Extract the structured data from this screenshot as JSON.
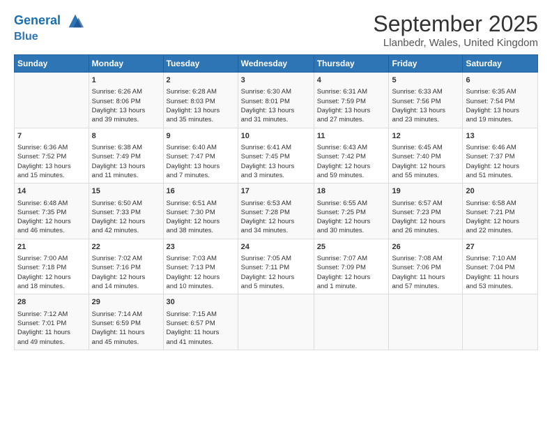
{
  "header": {
    "logo_line1": "General",
    "logo_line2": "Blue",
    "month": "September 2025",
    "location": "Llanbedr, Wales, United Kingdom"
  },
  "weekdays": [
    "Sunday",
    "Monday",
    "Tuesday",
    "Wednesday",
    "Thursday",
    "Friday",
    "Saturday"
  ],
  "weeks": [
    [
      {
        "day": "",
        "content": ""
      },
      {
        "day": "1",
        "content": "Sunrise: 6:26 AM\nSunset: 8:06 PM\nDaylight: 13 hours\nand 39 minutes."
      },
      {
        "day": "2",
        "content": "Sunrise: 6:28 AM\nSunset: 8:03 PM\nDaylight: 13 hours\nand 35 minutes."
      },
      {
        "day": "3",
        "content": "Sunrise: 6:30 AM\nSunset: 8:01 PM\nDaylight: 13 hours\nand 31 minutes."
      },
      {
        "day": "4",
        "content": "Sunrise: 6:31 AM\nSunset: 7:59 PM\nDaylight: 13 hours\nand 27 minutes."
      },
      {
        "day": "5",
        "content": "Sunrise: 6:33 AM\nSunset: 7:56 PM\nDaylight: 13 hours\nand 23 minutes."
      },
      {
        "day": "6",
        "content": "Sunrise: 6:35 AM\nSunset: 7:54 PM\nDaylight: 13 hours\nand 19 minutes."
      }
    ],
    [
      {
        "day": "7",
        "content": "Sunrise: 6:36 AM\nSunset: 7:52 PM\nDaylight: 13 hours\nand 15 minutes."
      },
      {
        "day": "8",
        "content": "Sunrise: 6:38 AM\nSunset: 7:49 PM\nDaylight: 13 hours\nand 11 minutes."
      },
      {
        "day": "9",
        "content": "Sunrise: 6:40 AM\nSunset: 7:47 PM\nDaylight: 13 hours\nand 7 minutes."
      },
      {
        "day": "10",
        "content": "Sunrise: 6:41 AM\nSunset: 7:45 PM\nDaylight: 13 hours\nand 3 minutes."
      },
      {
        "day": "11",
        "content": "Sunrise: 6:43 AM\nSunset: 7:42 PM\nDaylight: 12 hours\nand 59 minutes."
      },
      {
        "day": "12",
        "content": "Sunrise: 6:45 AM\nSunset: 7:40 PM\nDaylight: 12 hours\nand 55 minutes."
      },
      {
        "day": "13",
        "content": "Sunrise: 6:46 AM\nSunset: 7:37 PM\nDaylight: 12 hours\nand 51 minutes."
      }
    ],
    [
      {
        "day": "14",
        "content": "Sunrise: 6:48 AM\nSunset: 7:35 PM\nDaylight: 12 hours\nand 46 minutes."
      },
      {
        "day": "15",
        "content": "Sunrise: 6:50 AM\nSunset: 7:33 PM\nDaylight: 12 hours\nand 42 minutes."
      },
      {
        "day": "16",
        "content": "Sunrise: 6:51 AM\nSunset: 7:30 PM\nDaylight: 12 hours\nand 38 minutes."
      },
      {
        "day": "17",
        "content": "Sunrise: 6:53 AM\nSunset: 7:28 PM\nDaylight: 12 hours\nand 34 minutes."
      },
      {
        "day": "18",
        "content": "Sunrise: 6:55 AM\nSunset: 7:25 PM\nDaylight: 12 hours\nand 30 minutes."
      },
      {
        "day": "19",
        "content": "Sunrise: 6:57 AM\nSunset: 7:23 PM\nDaylight: 12 hours\nand 26 minutes."
      },
      {
        "day": "20",
        "content": "Sunrise: 6:58 AM\nSunset: 7:21 PM\nDaylight: 12 hours\nand 22 minutes."
      }
    ],
    [
      {
        "day": "21",
        "content": "Sunrise: 7:00 AM\nSunset: 7:18 PM\nDaylight: 12 hours\nand 18 minutes."
      },
      {
        "day": "22",
        "content": "Sunrise: 7:02 AM\nSunset: 7:16 PM\nDaylight: 12 hours\nand 14 minutes."
      },
      {
        "day": "23",
        "content": "Sunrise: 7:03 AM\nSunset: 7:13 PM\nDaylight: 12 hours\nand 10 minutes."
      },
      {
        "day": "24",
        "content": "Sunrise: 7:05 AM\nSunset: 7:11 PM\nDaylight: 12 hours\nand 5 minutes."
      },
      {
        "day": "25",
        "content": "Sunrise: 7:07 AM\nSunset: 7:09 PM\nDaylight: 12 hours\nand 1 minute."
      },
      {
        "day": "26",
        "content": "Sunrise: 7:08 AM\nSunset: 7:06 PM\nDaylight: 11 hours\nand 57 minutes."
      },
      {
        "day": "27",
        "content": "Sunrise: 7:10 AM\nSunset: 7:04 PM\nDaylight: 11 hours\nand 53 minutes."
      }
    ],
    [
      {
        "day": "28",
        "content": "Sunrise: 7:12 AM\nSunset: 7:01 PM\nDaylight: 11 hours\nand 49 minutes."
      },
      {
        "day": "29",
        "content": "Sunrise: 7:14 AM\nSunset: 6:59 PM\nDaylight: 11 hours\nand 45 minutes."
      },
      {
        "day": "30",
        "content": "Sunrise: 7:15 AM\nSunset: 6:57 PM\nDaylight: 11 hours\nand 41 minutes."
      },
      {
        "day": "",
        "content": ""
      },
      {
        "day": "",
        "content": ""
      },
      {
        "day": "",
        "content": ""
      },
      {
        "day": "",
        "content": ""
      }
    ]
  ]
}
